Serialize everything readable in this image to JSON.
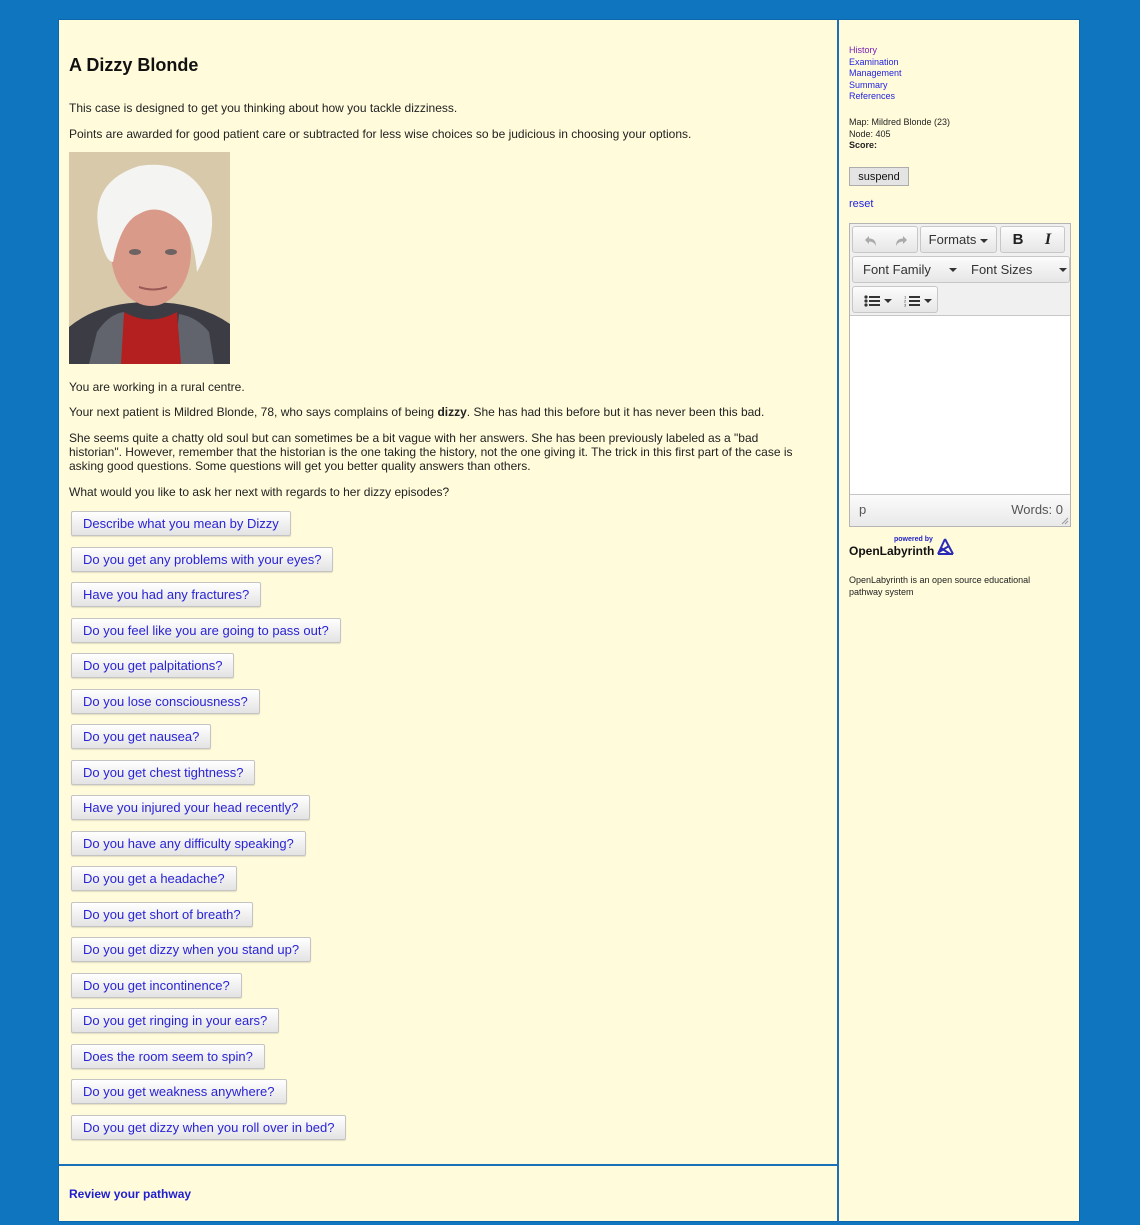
{
  "main": {
    "title": "A Dizzy Blonde",
    "intro": "This case is designed to get you thinking about how you tackle dizziness.",
    "points_note": "Points are awarded for good patient care or subtracted for less wise choices so be judicious in choosing your options.",
    "photo_alt": "Photo of elderly woman with white hair",
    "setting": "You are working in a rural centre.",
    "patient_pre": "Your next patient is Mildred Blonde, 78, who says complains of being ",
    "patient_bold": "dizzy",
    "patient_post": ". She has had this before but it has never been this bad.",
    "history_note": "She seems quite a chatty old soul but can sometimes be a bit vague with her answers. She has been previously labeled as a \"bad historian\". However, remember that the historian is the one taking the history, not the one giving it. The trick in this first part of the case is asking good questions. Some questions will get you better quality answers than others.",
    "prompt": "What would you like to ask her next with regards to her dizzy episodes?",
    "questions": [
      "Describe what you mean by Dizzy",
      "Do you get any problems with your eyes?",
      "Have you had any fractures?",
      "Do you feel like you are going to pass out?",
      "Do you get palpitations?",
      "Do you lose consciousness?",
      "Do you get nausea?",
      "Do you get chest tightness?",
      "Have you injured your head recently?",
      "Do you have any difficulty speaking?",
      "Do you get a headache?",
      "Do you get short of breath?",
      "Do you get dizzy when you stand up?",
      "Do you get incontinence?",
      "Do you get ringing in your ears?",
      "Does the room seem to spin?",
      "Do you get weakness anywhere?",
      "Do you get dizzy when you roll over in bed?"
    ]
  },
  "footer": {
    "review_link": "Review your pathway"
  },
  "sidebar": {
    "nav": [
      "History",
      "Examination",
      "Management",
      "Summary",
      "References"
    ],
    "map_info": "Map: Mildred Blonde (23)",
    "node_info": "Node: 405",
    "score_label": "Score:",
    "suspend_label": "suspend",
    "reset_label": "reset",
    "editor": {
      "formats_label": "Formats",
      "bold_label": "B",
      "italic_label": "I",
      "font_family_label": "Font Family",
      "font_sizes_label": "Font Sizes",
      "path_label": "p",
      "word_count": "Words: 0"
    },
    "powered_by": "powered by",
    "brand": "OpenLabyrinth",
    "about": "OpenLabyrinth is an open source educational pathway system"
  },
  "colors": {
    "background": "#0e75be",
    "panel": "#fffbdb",
    "link": "#2323e0",
    "visited_link": "#7b1fb3"
  }
}
